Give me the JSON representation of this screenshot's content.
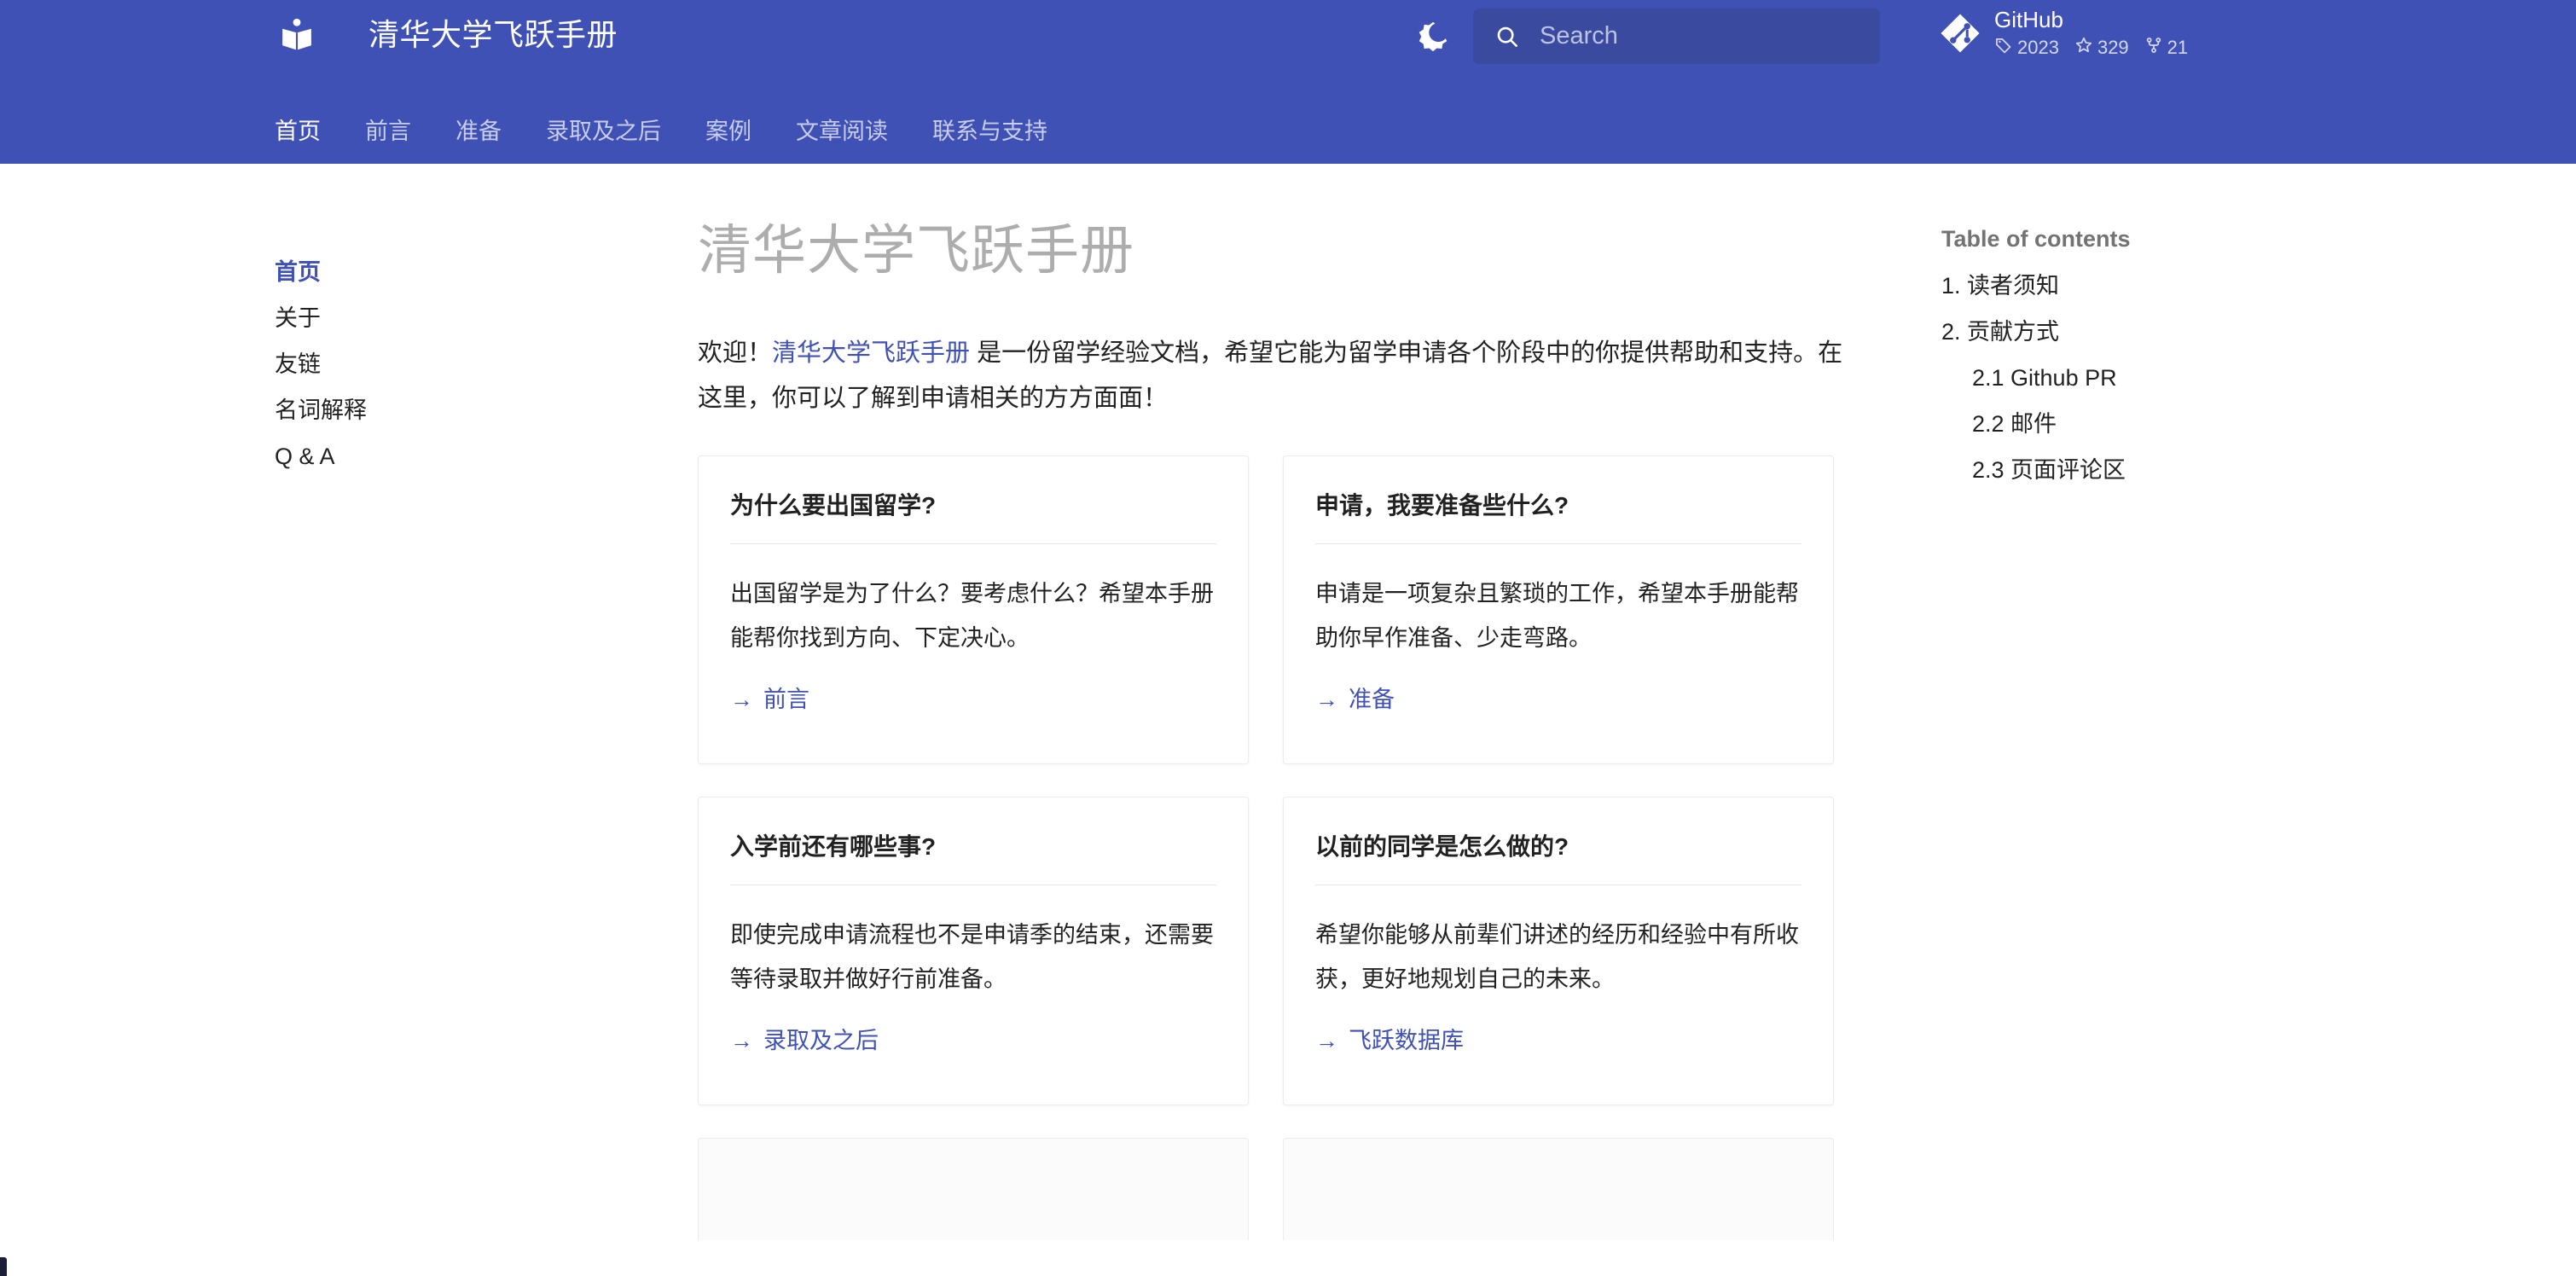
{
  "header": {
    "logo_icon": "book-logo-icon",
    "site_title": "清华大学飞跃手册",
    "theme_toggle_icon": "brightness-moon-icon",
    "search": {
      "icon": "search-icon",
      "placeholder": "Search",
      "value": ""
    },
    "repo": {
      "icon": "git-diamond-icon",
      "name": "GitHub",
      "stats": [
        {
          "icon": "tag-icon",
          "value": "2023"
        },
        {
          "icon": "star-icon",
          "value": "329"
        },
        {
          "icon": "fork-icon",
          "value": "21"
        }
      ]
    },
    "tabs": [
      {
        "label": "首页",
        "active": true
      },
      {
        "label": "前言",
        "active": false
      },
      {
        "label": "准备",
        "active": false
      },
      {
        "label": "录取及之后",
        "active": false
      },
      {
        "label": "案例",
        "active": false
      },
      {
        "label": "文章阅读",
        "active": false
      },
      {
        "label": "联系与支持",
        "active": false
      }
    ]
  },
  "sidebar": {
    "items": [
      {
        "label": "首页",
        "active": true
      },
      {
        "label": "关于",
        "active": false
      },
      {
        "label": "友链",
        "active": false
      },
      {
        "label": "名词解释",
        "active": false
      },
      {
        "label": "Q & A",
        "active": false
      }
    ]
  },
  "main": {
    "page_title": "清华大学飞跃手册",
    "intro": {
      "before": "欢迎！",
      "link": "清华大学飞跃手册",
      "after": " 是一份留学经验文档，希望它能为留学申请各个阶段中的你提供帮助和支持。在这里，你可以了解到申请相关的方方面面！"
    },
    "cards": [
      {
        "title": "为什么要出国留学?",
        "body": "出国留学是为了什么？要考虑什么？希望本手册能帮你找到方向、下定决心。",
        "link_arrow": "→",
        "link_label": "前言"
      },
      {
        "title": "申请，我要准备些什么?",
        "body": "申请是一项复杂且繁琐的工作，希望本手册能帮助你早作准备、少走弯路。",
        "link_arrow": "→",
        "link_label": "准备"
      },
      {
        "title": "入学前还有哪些事?",
        "body": "即使完成申请流程也不是申请季的结束，还需要等待录取并做好行前准备。",
        "link_arrow": "→",
        "link_label": "录取及之后"
      },
      {
        "title": "以前的同学是怎么做的?",
        "body": "希望你能够从前辈们讲述的经历和经验中有所收获，更好地规划自己的未来。",
        "link_arrow": "→",
        "link_label": "飞跃数据库"
      }
    ]
  },
  "toc": {
    "title": "Table of contents",
    "items": [
      {
        "label": "1. 读者须知",
        "level": 1
      },
      {
        "label": "2. 贡献方式",
        "level": 1
      },
      {
        "label": "2.1 Github PR",
        "level": 2
      },
      {
        "label": "2.2 邮件",
        "level": 2
      },
      {
        "label": "2.3 页面评论区",
        "level": 2
      }
    ]
  },
  "colors": {
    "primary": "#4051b5",
    "search_bg": "#3a4a9e",
    "link": "#4051b5",
    "title_gray": "#adadad",
    "toc_title_gray": "#737373",
    "card_border": "#ececec"
  }
}
